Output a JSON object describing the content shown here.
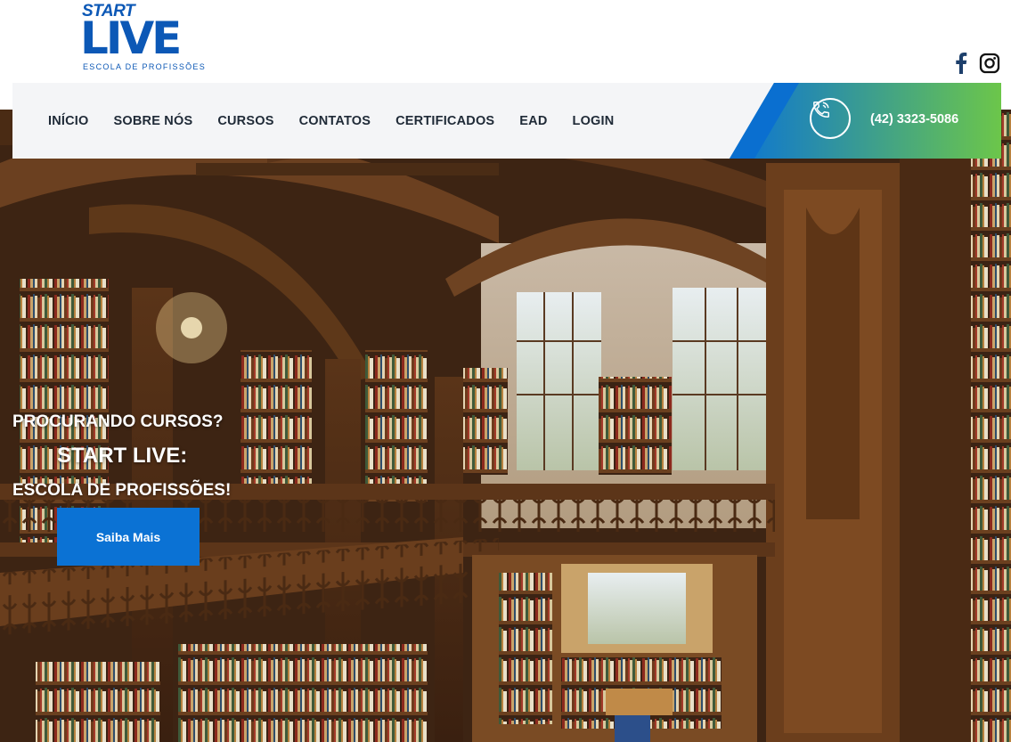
{
  "brand": {
    "logo_top": "START",
    "logo_main": "LIVE",
    "logo_sub": "ESCOLA DE PROFISSÕES",
    "colors": {
      "primary_blue": "#0c58b6",
      "accent_yellow": "#f5d90a",
      "accent_green": "#6cc64a"
    }
  },
  "social": {
    "items": [
      {
        "icon": "facebook-icon"
      },
      {
        "icon": "instagram-icon"
      }
    ]
  },
  "nav": {
    "items": [
      {
        "label": "INÍCIO"
      },
      {
        "label": "SOBRE NÓS"
      },
      {
        "label": "CURSOS"
      },
      {
        "label": "CONTATOS"
      },
      {
        "label": "CERTIFICADOS"
      },
      {
        "label": "EAD"
      },
      {
        "label": "LOGIN"
      }
    ],
    "phone": {
      "icon": "phone-icon",
      "number": "(42) 3323-5086",
      "gradient": [
        "#0a73d6",
        "#6cc64a"
      ]
    }
  },
  "hero": {
    "line1": "PROCURANDO CURSOS?",
    "line2": "START LIVE:",
    "line3": "ESCOLA DE PROFISSÕES!",
    "cta_label": "Saiba Mais",
    "cta_color": "#0b72d4"
  }
}
